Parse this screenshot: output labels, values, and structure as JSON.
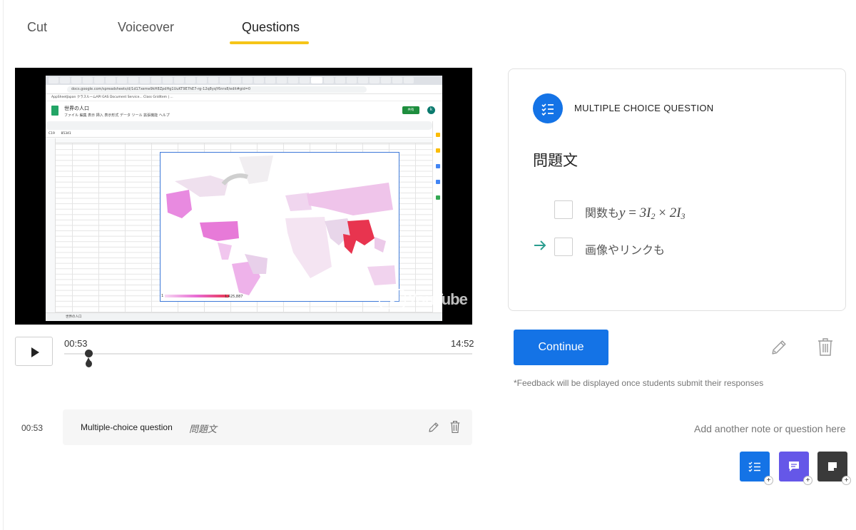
{
  "tabs": {
    "cut": "Cut",
    "voiceover": "Voiceover",
    "questions": "Questions",
    "active": "Questions"
  },
  "video": {
    "browser_url": "docs.google.com/spreadsheets/d/1d17xeme9kH8ZpdHg1UuKT9E7hE7-rg-12q8yqY6nrx8/edit#gid=0",
    "bookmarks": "AppSheetJapan   クラスルームAPI   GAS   Document Service...   Class GridItem | ...",
    "sheet_title": "世界の人口",
    "sheet_menu": "ファイル  編集  表示  挿入  表示形式  データ  ツール  拡張機能  ヘルプ",
    "share_label": "共有",
    "avatar_letter": "k",
    "cell_ref": "C19",
    "cell_value": "85341",
    "sheet_tab": "世界の人口",
    "legend_min": "1",
    "legend_max": "1,425,887",
    "watermark": "YouTube",
    "current_time": "00:53",
    "total_time": "14:52",
    "progress_fraction": 0.06
  },
  "timeline": {
    "time": "00:53",
    "type": "Multiple-choice question",
    "text": "問題文"
  },
  "card": {
    "heading": "MULTIPLE CHOICE QUESTION",
    "prompt": "問題文",
    "choices": [
      {
        "prefix": "関数も",
        "math": "y = 3I2 × 2I3",
        "correct": false
      },
      {
        "label": "画像やリンクも",
        "correct": true
      }
    ]
  },
  "actions": {
    "continue": "Continue",
    "feedback_note": "*Feedback will be displayed once students submit their responses",
    "add_note": "Add another note or question here",
    "plus": "+"
  },
  "colors": {
    "accent": "#1473e6",
    "tab_underline": "#f5c518",
    "chat": "#6557e8",
    "note": "#3a3a3a",
    "correct": "#2a9d8f"
  },
  "icons": [
    "checklist-icon",
    "pencil-icon",
    "trash-icon",
    "arrow-right-icon",
    "chat-icon",
    "sticky-note-icon",
    "play-icon"
  ]
}
